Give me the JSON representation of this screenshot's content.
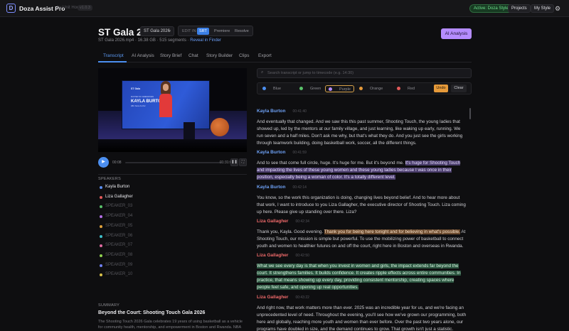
{
  "topbar": {
    "logo": "D",
    "app_title": "Doza Assist Pro",
    "subtitle": "by Unit House",
    "version": "v1.0.3",
    "active_style": "Active: Doza Style",
    "projects": "Projects",
    "my_style": "My Style",
    "settings_icon": "gear-icon"
  },
  "header": {
    "title": "ST Gala 2026",
    "project_select": "ST Gala 2026",
    "edit_label": "EDIT IN:",
    "edit_options": [
      "SRT",
      "Premiere",
      "Resolve"
    ],
    "file_info": "ST Gala 2026.mp4 · 16.38 GB · 515 segments · ",
    "reveal": "Reveal in Finder",
    "ai_button": "AI Analysis"
  },
  "tabs": [
    "Transcript",
    "AI Analysis",
    "Story Brief",
    "Chat",
    "Story Builder",
    "Clips",
    "Export"
  ],
  "active_tab": "Transcript",
  "video": {
    "brand": "ST Gala",
    "small_caption": "MASTER OF CEREMONIES",
    "name": "KAYLA BURTON",
    "role": "ABC News Anchor"
  },
  "player": {
    "current": "00:08",
    "duration": "01:31:02",
    "progress": 0.0
  },
  "speakers_header": "SPEAKERS",
  "speakers": [
    {
      "name": "Kayla Burton",
      "color": "#5a8df0",
      "dim": false
    },
    {
      "name": "Liza Gallagher",
      "color": "#e35a5a",
      "dim": false
    },
    {
      "name": "SPEAKER_03",
      "color": "#59c26a",
      "dim": true
    },
    {
      "name": "SPEAKER_04",
      "color": "#b46ee6",
      "dim": true
    },
    {
      "name": "SPEAKER_05",
      "color": "#e0a13a",
      "dim": true
    },
    {
      "name": "SPEAKER_06",
      "color": "#3fbfc9",
      "dim": true
    },
    {
      "name": "SPEAKER_07",
      "color": "#e06aa0",
      "dim": true
    },
    {
      "name": "SPEAKER_08",
      "color": "#8fd14f",
      "dim": true
    },
    {
      "name": "SPEAKER_09",
      "color": "#6f7ff0",
      "dim": true
    },
    {
      "name": "SPEAKER_10",
      "color": "#d9c24a",
      "dim": true
    }
  ],
  "summary": {
    "header": "SUMMARY",
    "title": "Beyond the Court: Shooting Touch Gala 2026",
    "body": "The Shooting Touch 2026 Gala celebrates 19 years of using basketball as a vehicle for community health, mentorship, and empowerment in Boston and Rwanda. NBA players"
  },
  "search": {
    "placeholder": "Search transcript or jump to timecode (e.g. 14:30)"
  },
  "highlight_colors": [
    {
      "name": "Blue",
      "color": "#4c8ff0"
    },
    {
      "name": "Green",
      "color": "#59c26a"
    },
    {
      "name": "Purple",
      "color": "#b58cff"
    },
    {
      "name": "Orange",
      "color": "#e69a3a"
    },
    {
      "name": "Red",
      "color": "#e35a5a"
    }
  ],
  "selected_highlight": "Purple",
  "undo": "Undo",
  "clear": "Clear",
  "transcript": [
    {
      "speaker": "Kayla Burton",
      "color": "#6ea1f5",
      "ts": "00:41:40",
      "parts": [
        {
          "t": "And eventually that changed. And we saw this this past summer, Shooting Touch, the young ladies that showed up, led by the mentors at our family village, and just learning, like waking up early, running. We run seven and a half miles. Don't ask me why, but that's what they do. And you just see the girls working through teamwork building, doing basketball work, soccer, all the different things.",
          "hl": ""
        }
      ]
    },
    {
      "speaker": "Kayla Burton",
      "color": "#6ea1f5",
      "ts": "00:41:59",
      "parts": [
        {
          "t": "And to see that come full circle, huge. It's huge for me. But it's beyond me. ",
          "hl": ""
        },
        {
          "t": "It's huge for Shooting Touch and impacting the lives of these young women and these young ladies because I was once in their position, especially being a woman of color. It's a totally different level.",
          "hl": "purple"
        }
      ]
    },
    {
      "speaker": "Kayla Burton",
      "color": "#6ea1f5",
      "ts": "00:42:14",
      "parts": [
        {
          "t": "You know, so the work this organization is doing, changing lives beyond belief. And to hear more about that work, I want to introduce to you Liza Gallagher, the executive director of Shooting Touch. Liza coming up here. Please give up standing over there. Liza?",
          "hl": ""
        }
      ]
    },
    {
      "speaker": "Liza Gallagher",
      "color": "#ef6a6a",
      "ts": "00:42:34",
      "parts": [
        {
          "t": "Thank you, Kayla. Good evening. ",
          "hl": ""
        },
        {
          "t": "Thank you for being here tonight and for believing in what's possible.",
          "hl": "orange"
        },
        {
          "t": " At Shooting Touch, our mission is simple but powerful. To use the mobilizing power of basketball to connect youth and women to healthier futures on and off the court, right here in Boston and overseas in Rwanda.",
          "hl": ""
        }
      ]
    },
    {
      "speaker": "Liza Gallagher",
      "color": "#ef6a6a",
      "ts": "00:42:50",
      "parts": [
        {
          "t": "What we see every day is that when you invest in women and girls, the impact extends far beyond the court. It strengthens families. It builds confidence. It creates ripple effects across entire communities. In practice, that means showing up every day, providing consistent mentorship, creating spaces where people feel safe, and opening up real opportunities.",
          "hl": "green"
        }
      ]
    },
    {
      "speaker": "Liza Gallagher",
      "color": "#ef6a6a",
      "ts": "00:43:22",
      "parts": [
        {
          "t": "And right now, that work matters more than ever. 2025 was an incredible year for us, and we're facing an unprecedented level of need. Throughout the evening, you'll see how we've grown our programming, both here and globally, reaching more youth and women than ever before. Over the past two years alone, our programs have doubled in size, and the demand continues to grow. That growth isn't just a statistic.",
          "hl": ""
        }
      ]
    }
  ]
}
